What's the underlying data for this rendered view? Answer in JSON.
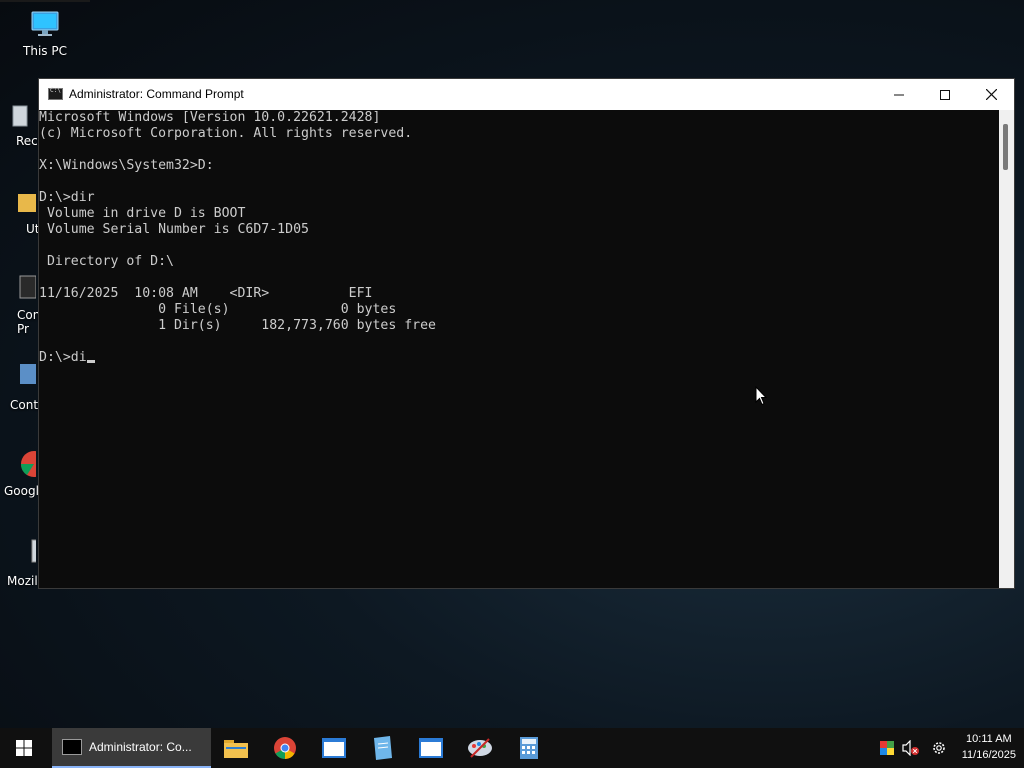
{
  "desktop": {
    "icons": [
      {
        "label": "This PC",
        "icon": "monitor-icon"
      },
      {
        "label": "Recy",
        "icon": "recycle-bin-icon"
      },
      {
        "label": "Ut",
        "icon": "folder-icon"
      },
      {
        "label": "Con\nPr",
        "icon": "command-prompt-icon"
      },
      {
        "label": "Contr",
        "icon": "control-panel-icon"
      },
      {
        "label": "Googl",
        "icon": "chrome-icon"
      },
      {
        "label": "Mozill",
        "icon": "mozilla-icon"
      }
    ]
  },
  "window": {
    "title": "Administrator: Command Prompt",
    "console_lines": [
      "Microsoft Windows [Version 10.0.22621.2428]",
      "(c) Microsoft Corporation. All rights reserved.",
      "",
      "X:\\Windows\\System32>D:",
      "",
      "D:\\>dir",
      " Volume in drive D is BOOT",
      " Volume Serial Number is C6D7-1D05",
      "",
      " Directory of D:\\",
      "",
      "11/16/2025  10:08 AM    <DIR>          EFI",
      "               0 File(s)              0 bytes",
      "               1 Dir(s)     182,773,760 bytes free",
      ""
    ],
    "current_input": "D:\\>di"
  },
  "taskbar": {
    "active_task_label": "Administrator: Co...",
    "pinned": [
      "file-explorer-icon",
      "chrome-icon",
      "app-window-icon",
      "notepad-icon",
      "app-window-icon",
      "paint-icon",
      "calculator-icon"
    ],
    "clock_time": "10:11 AM",
    "clock_date": "11/16/2025"
  },
  "colors": {
    "console_bg": "#0c0c0c",
    "console_fg": "#cccccc",
    "taskbar_bg": "#101010"
  }
}
